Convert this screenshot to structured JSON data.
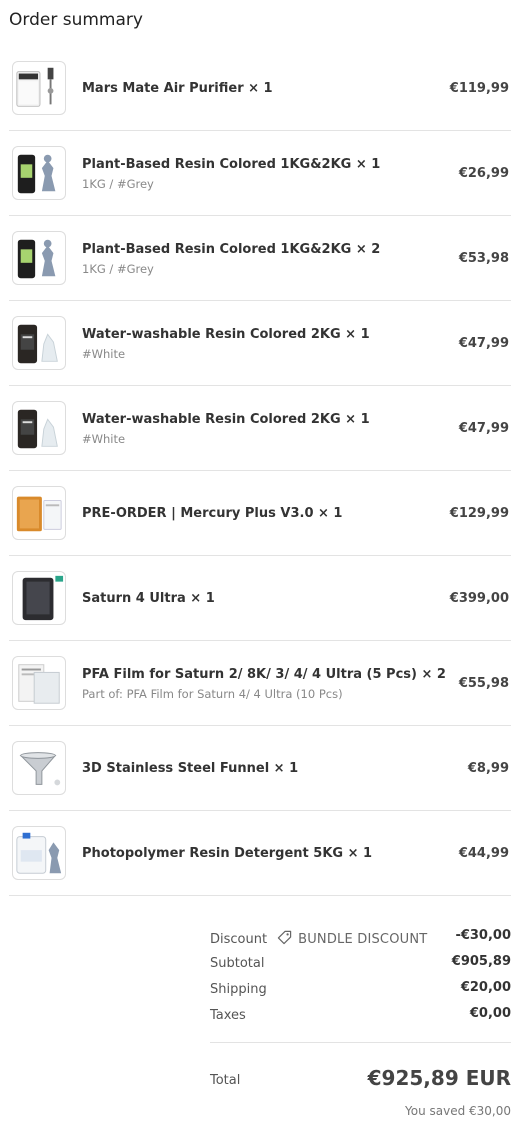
{
  "title": "Order summary",
  "items": [
    {
      "name": "Mars Mate Air Purifier × 1",
      "variant": "",
      "price": "€119,99",
      "icon": "air-purifier-thumbnail"
    },
    {
      "name": "Plant-Based Resin Colored 1KG&2KG × 1",
      "variant": "1KG / #Grey",
      "price": "€26,99",
      "icon": "resin-bottle-thumbnail"
    },
    {
      "name": "Plant-Based Resin Colored 1KG&2KG × 2",
      "variant": "1KG / #Grey",
      "price": "€53,98",
      "icon": "resin-bottle-thumbnail"
    },
    {
      "name": "Water-washable Resin Colored 2KG × 1",
      "variant": "#White",
      "price": "€47,99",
      "icon": "resin-bottle-thumbnail"
    },
    {
      "name": "Water-washable Resin Colored 2KG × 1",
      "variant": "#White",
      "price": "€47,99",
      "icon": "resin-bottle-thumbnail"
    },
    {
      "name": "PRE-ORDER | Mercury Plus V3.0 × 1",
      "variant": "",
      "price": "€129,99",
      "icon": "wash-cure-machine-thumbnail"
    },
    {
      "name": "Saturn 4 Ultra × 1",
      "variant": "",
      "price": "€399,00",
      "icon": "3d-printer-thumbnail"
    },
    {
      "name": "PFA Film for Saturn 2/ 8K/ 3/ 4/ 4 Ultra (5 Pcs) × 2",
      "variant": "Part of: PFA Film for Saturn 4/ 4 Ultra (10 Pcs)",
      "price": "€55,98",
      "icon": "pfa-film-thumbnail"
    },
    {
      "name": "3D Stainless Steel Funnel × 1",
      "variant": "",
      "price": "€8,99",
      "icon": "funnel-thumbnail"
    },
    {
      "name": "Photopolymer Resin Detergent 5KG × 1",
      "variant": "",
      "price": "€44,99",
      "icon": "detergent-canister-thumbnail"
    }
  ],
  "summary": {
    "discount_label": "Discount",
    "discount_code": "BUNDLE DISCOUNT",
    "discount_value": "-€30,00",
    "subtotal_label": "Subtotal",
    "subtotal_value": "€905,89",
    "shipping_label": "Shipping",
    "shipping_value": "€20,00",
    "taxes_label": "Taxes",
    "taxes_value": "€0,00",
    "total_label": "Total",
    "total_value": "€925,89 EUR",
    "saved_text": "You saved €30,00"
  },
  "colors": {
    "divider": "#e3e3e3",
    "text": "#333333",
    "muted": "#888888"
  }
}
